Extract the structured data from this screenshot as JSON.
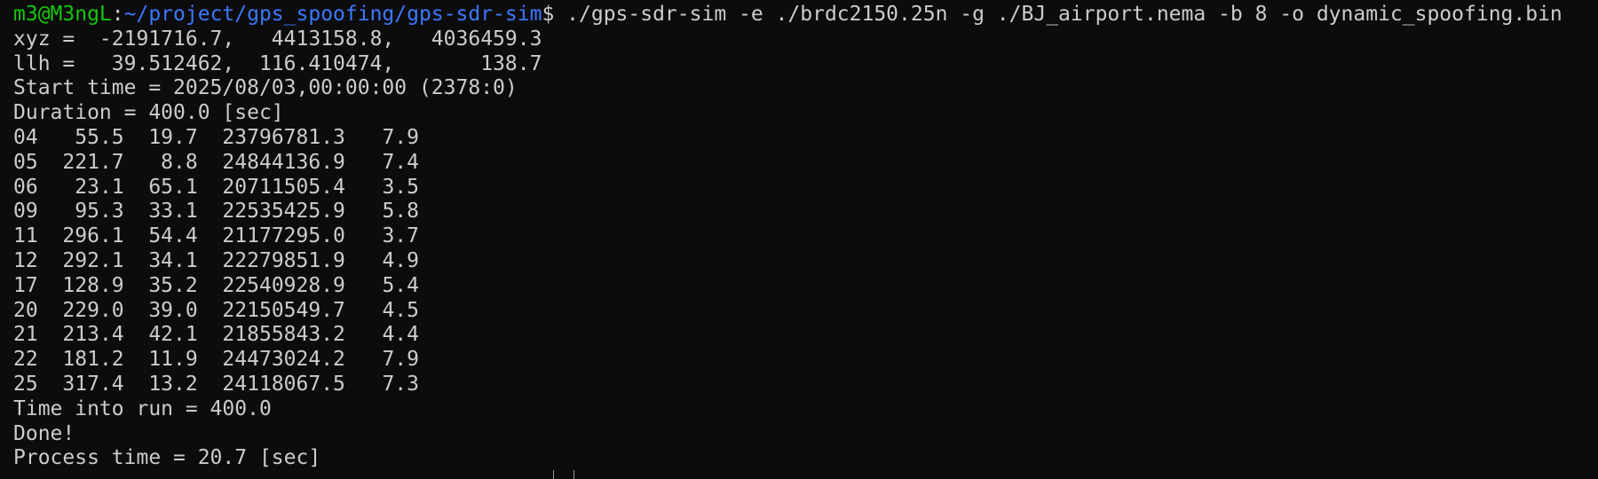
{
  "terminal": {
    "prompt": {
      "user_host": "m3@M3ngL",
      "colon": ":",
      "path": "~/project/gps_spoofing/gps-sdr-sim",
      "symbol": "$",
      "command": " ./gps-sdr-sim -e ./brdc2150.25n -g ./BJ_airport.nema -b 8 -o dynamic_spoofing.bin"
    },
    "header_lines": [
      "xyz =  -2191716.7,   4413158.8,   4036459.3",
      "llh =   39.512462,  116.410474,       138.7",
      "Start time = 2025/08/03,00:00:00 (2378:0)",
      "Duration = 400.0 [sec]"
    ],
    "satellites": [
      {
        "prn": "04",
        "az": "55.5",
        "el": "19.7",
        "range": "23796781.3",
        "iono": "7.9"
      },
      {
        "prn": "05",
        "az": "221.7",
        "el": "8.8",
        "range": "24844136.9",
        "iono": "7.4"
      },
      {
        "prn": "06",
        "az": "23.1",
        "el": "65.1",
        "range": "20711505.4",
        "iono": "3.5"
      },
      {
        "prn": "09",
        "az": "95.3",
        "el": "33.1",
        "range": "22535425.9",
        "iono": "5.8"
      },
      {
        "prn": "11",
        "az": "296.1",
        "el": "54.4",
        "range": "21177295.0",
        "iono": "3.7"
      },
      {
        "prn": "12",
        "az": "292.1",
        "el": "34.1",
        "range": "22279851.9",
        "iono": "4.9"
      },
      {
        "prn": "17",
        "az": "128.9",
        "el": "35.2",
        "range": "22540928.9",
        "iono": "5.4"
      },
      {
        "prn": "20",
        "az": "229.0",
        "el": "39.0",
        "range": "22150549.7",
        "iono": "4.5"
      },
      {
        "prn": "21",
        "az": "213.4",
        "el": "42.1",
        "range": "21855843.2",
        "iono": "4.4"
      },
      {
        "prn": "22",
        "az": "181.2",
        "el": "11.9",
        "range": "24473024.2",
        "iono": "7.9"
      },
      {
        "prn": "25",
        "az": "317.4",
        "el": "13.2",
        "range": "24118067.5",
        "iono": "7.3"
      }
    ],
    "footer_lines": [
      "Time into run = 400.0",
      "Done!",
      "Process time = 20.7 [sec]"
    ],
    "colors": {
      "background": "#0c0c0c",
      "text": "#cccccc",
      "user_host": "#16c60c",
      "path": "#3b78ff"
    }
  }
}
